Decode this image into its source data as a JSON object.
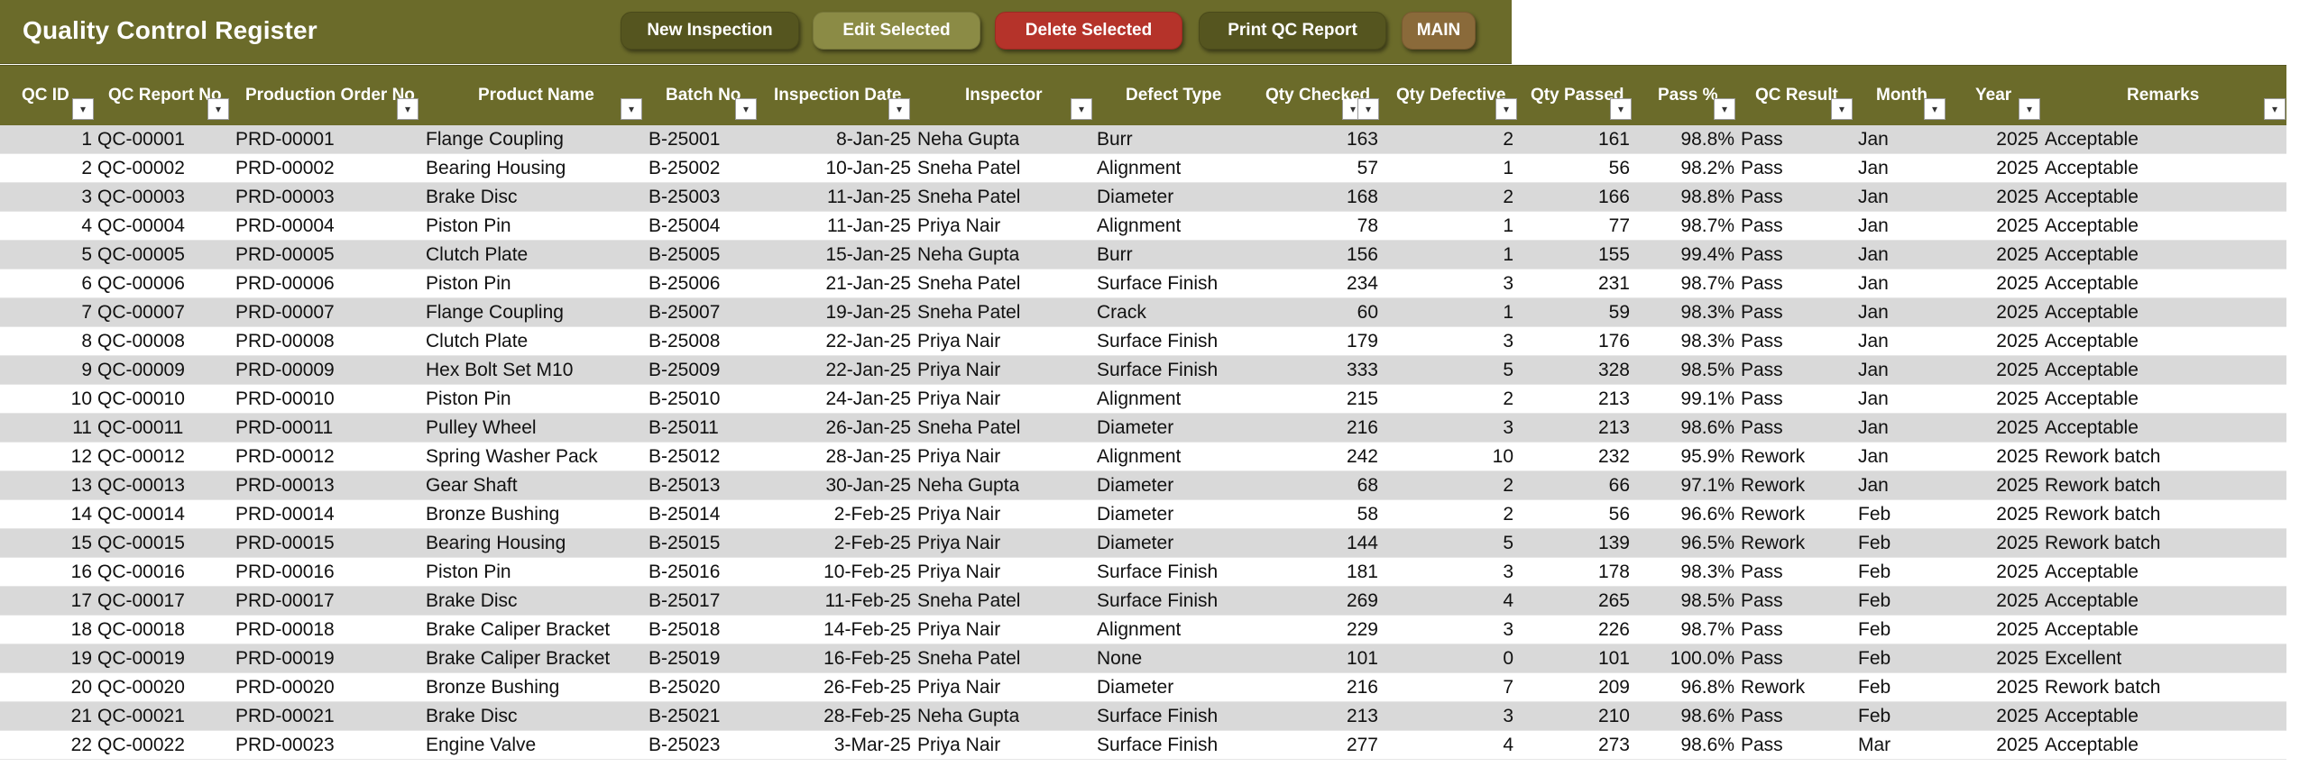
{
  "app": {
    "title": "Quality Control Register"
  },
  "toolbar": {
    "new_inspection": "New Inspection",
    "edit_selected": "Edit Selected",
    "delete_selected": "Delete Selected",
    "print_report": "Print QC Report",
    "main": "MAIN"
  },
  "colors": {
    "header_bg": "#6b6b2a",
    "row_alt": "#d9d9d9",
    "delete_button": "#b5332a",
    "edit_button": "#8b8b45",
    "main_button": "#8a6a3a"
  },
  "table": {
    "columns": [
      "QC ID",
      "QC Report No",
      "Production Order No",
      "Product Name",
      "Batch No",
      "Inspection Date",
      "Inspector",
      "Defect Type",
      "Qty Checked",
      "Qty Defective",
      "Qty Passed",
      "Pass %",
      "QC Result",
      "Month",
      "Year",
      "Remarks"
    ],
    "rows": [
      [
        "1",
        "QC-00001",
        "PRD-00001",
        "Flange Coupling",
        "B-25001",
        "8-Jan-25",
        "Neha Gupta",
        "Burr",
        "163",
        "2",
        "161",
        "98.8%",
        "Pass",
        "Jan",
        "2025",
        "Acceptable"
      ],
      [
        "2",
        "QC-00002",
        "PRD-00002",
        "Bearing Housing",
        "B-25002",
        "10-Jan-25",
        "Sneha Patel",
        "Alignment",
        "57",
        "1",
        "56",
        "98.2%",
        "Pass",
        "Jan",
        "2025",
        "Acceptable"
      ],
      [
        "3",
        "QC-00003",
        "PRD-00003",
        "Brake Disc",
        "B-25003",
        "11-Jan-25",
        "Sneha Patel",
        "Diameter",
        "168",
        "2",
        "166",
        "98.8%",
        "Pass",
        "Jan",
        "2025",
        "Acceptable"
      ],
      [
        "4",
        "QC-00004",
        "PRD-00004",
        "Piston Pin",
        "B-25004",
        "11-Jan-25",
        "Priya Nair",
        "Alignment",
        "78",
        "1",
        "77",
        "98.7%",
        "Pass",
        "Jan",
        "2025",
        "Acceptable"
      ],
      [
        "5",
        "QC-00005",
        "PRD-00005",
        "Clutch Plate",
        "B-25005",
        "15-Jan-25",
        "Neha Gupta",
        "Burr",
        "156",
        "1",
        "155",
        "99.4%",
        "Pass",
        "Jan",
        "2025",
        "Acceptable"
      ],
      [
        "6",
        "QC-00006",
        "PRD-00006",
        "Piston Pin",
        "B-25006",
        "21-Jan-25",
        "Sneha Patel",
        "Surface Finish",
        "234",
        "3",
        "231",
        "98.7%",
        "Pass",
        "Jan",
        "2025",
        "Acceptable"
      ],
      [
        "7",
        "QC-00007",
        "PRD-00007",
        "Flange Coupling",
        "B-25007",
        "19-Jan-25",
        "Sneha Patel",
        "Crack",
        "60",
        "1",
        "59",
        "98.3%",
        "Pass",
        "Jan",
        "2025",
        "Acceptable"
      ],
      [
        "8",
        "QC-00008",
        "PRD-00008",
        "Clutch Plate",
        "B-25008",
        "22-Jan-25",
        "Priya Nair",
        "Surface Finish",
        "179",
        "3",
        "176",
        "98.3%",
        "Pass",
        "Jan",
        "2025",
        "Acceptable"
      ],
      [
        "9",
        "QC-00009",
        "PRD-00009",
        "Hex Bolt Set M10",
        "B-25009",
        "22-Jan-25",
        "Priya Nair",
        "Surface Finish",
        "333",
        "5",
        "328",
        "98.5%",
        "Pass",
        "Jan",
        "2025",
        "Acceptable"
      ],
      [
        "10",
        "QC-00010",
        "PRD-00010",
        "Piston Pin",
        "B-25010",
        "24-Jan-25",
        "Priya Nair",
        "Alignment",
        "215",
        "2",
        "213",
        "99.1%",
        "Pass",
        "Jan",
        "2025",
        "Acceptable"
      ],
      [
        "11",
        "QC-00011",
        "PRD-00011",
        "Pulley Wheel",
        "B-25011",
        "26-Jan-25",
        "Sneha Patel",
        "Diameter",
        "216",
        "3",
        "213",
        "98.6%",
        "Pass",
        "Jan",
        "2025",
        "Acceptable"
      ],
      [
        "12",
        "QC-00012",
        "PRD-00012",
        "Spring Washer Pack",
        "B-25012",
        "28-Jan-25",
        "Priya Nair",
        "Alignment",
        "242",
        "10",
        "232",
        "95.9%",
        "Rework",
        "Jan",
        "2025",
        "Rework batch"
      ],
      [
        "13",
        "QC-00013",
        "PRD-00013",
        "Gear Shaft",
        "B-25013",
        "30-Jan-25",
        "Neha Gupta",
        "Diameter",
        "68",
        "2",
        "66",
        "97.1%",
        "Rework",
        "Jan",
        "2025",
        "Rework batch"
      ],
      [
        "14",
        "QC-00014",
        "PRD-00014",
        "Bronze Bushing",
        "B-25014",
        "2-Feb-25",
        "Priya Nair",
        "Diameter",
        "58",
        "2",
        "56",
        "96.6%",
        "Rework",
        "Feb",
        "2025",
        "Rework batch"
      ],
      [
        "15",
        "QC-00015",
        "PRD-00015",
        "Bearing Housing",
        "B-25015",
        "2-Feb-25",
        "Priya Nair",
        "Diameter",
        "144",
        "5",
        "139",
        "96.5%",
        "Rework",
        "Feb",
        "2025",
        "Rework batch"
      ],
      [
        "16",
        "QC-00016",
        "PRD-00016",
        "Piston Pin",
        "B-25016",
        "10-Feb-25",
        "Priya Nair",
        "Surface Finish",
        "181",
        "3",
        "178",
        "98.3%",
        "Pass",
        "Feb",
        "2025",
        "Acceptable"
      ],
      [
        "17",
        "QC-00017",
        "PRD-00017",
        "Brake Disc",
        "B-25017",
        "11-Feb-25",
        "Sneha Patel",
        "Surface Finish",
        "269",
        "4",
        "265",
        "98.5%",
        "Pass",
        "Feb",
        "2025",
        "Acceptable"
      ],
      [
        "18",
        "QC-00018",
        "PRD-00018",
        "Brake Caliper Bracket",
        "B-25018",
        "14-Feb-25",
        "Priya Nair",
        "Alignment",
        "229",
        "3",
        "226",
        "98.7%",
        "Pass",
        "Feb",
        "2025",
        "Acceptable"
      ],
      [
        "19",
        "QC-00019",
        "PRD-00019",
        "Brake Caliper Bracket",
        "B-25019",
        "16-Feb-25",
        "Sneha Patel",
        "None",
        "101",
        "0",
        "101",
        "100.0%",
        "Pass",
        "Feb",
        "2025",
        "Excellent"
      ],
      [
        "20",
        "QC-00020",
        "PRD-00020",
        "Bronze Bushing",
        "B-25020",
        "26-Feb-25",
        "Priya Nair",
        "Diameter",
        "216",
        "7",
        "209",
        "96.8%",
        "Rework",
        "Feb",
        "2025",
        "Rework batch"
      ],
      [
        "21",
        "QC-00021",
        "PRD-00021",
        "Brake Disc",
        "B-25021",
        "28-Feb-25",
        "Neha Gupta",
        "Surface Finish",
        "213",
        "3",
        "210",
        "98.6%",
        "Pass",
        "Feb",
        "2025",
        "Acceptable"
      ],
      [
        "22",
        "QC-00022",
        "PRD-00023",
        "Engine Valve",
        "B-25023",
        "3-Mar-25",
        "Priya Nair",
        "Surface Finish",
        "277",
        "4",
        "273",
        "98.6%",
        "Pass",
        "Mar",
        "2025",
        "Acceptable"
      ]
    ]
  }
}
